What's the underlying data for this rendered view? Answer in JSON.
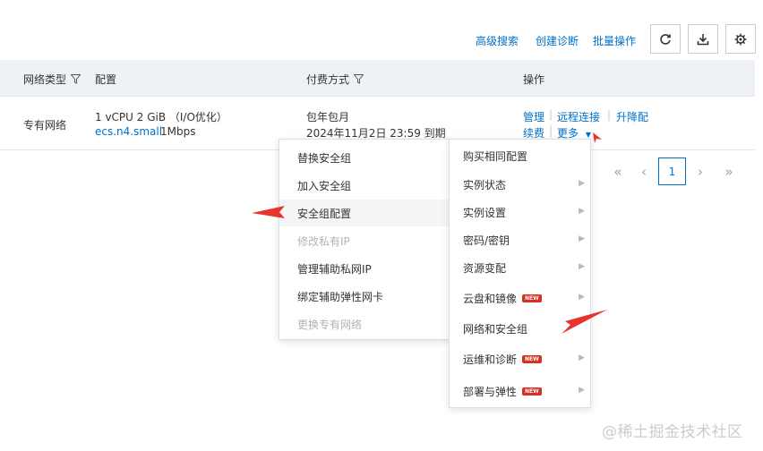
{
  "toolbar": {
    "advanced_search": "高级搜索",
    "create_diagnosis": "创建诊断",
    "batch_operations": "批量操作",
    "refresh_icon": "refresh-icon",
    "download_icon": "download-icon",
    "settings_icon": "gear-icon"
  },
  "table": {
    "headers": {
      "network_type": "网络类型",
      "config": "配置",
      "billing": "付费方式",
      "actions": "操作"
    },
    "row": {
      "network_type": "专有网络",
      "config_line1": "1 vCPU 2 GiB （I/O优化）",
      "instance_type": "ecs.n4.small",
      "bandwidth": "1Mbps",
      "billing_type": "包年包月",
      "expiry": "2024年11月2日 23:59 到期",
      "action_manage": "管理",
      "action_remote": "远程连接",
      "action_upgrade": "升降配",
      "action_renew": "续费",
      "action_more": "更多"
    }
  },
  "pagination": {
    "first": "«",
    "prev": "‹",
    "current": "1",
    "next": "›",
    "last": "»"
  },
  "submenu": {
    "items": [
      {
        "label": "替换安全组",
        "disabled": false
      },
      {
        "label": "加入安全组",
        "disabled": false
      },
      {
        "label": "安全组配置",
        "disabled": false
      },
      {
        "label": "修改私有IP",
        "disabled": true
      },
      {
        "label": "管理辅助私网IP",
        "disabled": false
      },
      {
        "label": "绑定辅助弹性网卡",
        "disabled": false
      },
      {
        "label": "更换专有网络",
        "disabled": true
      }
    ]
  },
  "more_menu": {
    "new_badge": "NEW",
    "items": [
      {
        "label": "购买相同配置"
      },
      {
        "label": "实例状态"
      },
      {
        "label": "实例设置"
      },
      {
        "label": "密码/密钥"
      },
      {
        "label": "资源变配"
      },
      {
        "label": "云盘和镜像"
      },
      {
        "label": "网络和安全组"
      },
      {
        "label": "运维和诊断"
      },
      {
        "label": "部署与弹性"
      }
    ]
  },
  "annotations": {
    "arrow_color": "#e8332f"
  },
  "watermark": "@稀土掘金技术社区",
  "colors": {
    "link": "#0070cc",
    "header_bg": "#eef2f6",
    "new_badge": "#d93026"
  }
}
